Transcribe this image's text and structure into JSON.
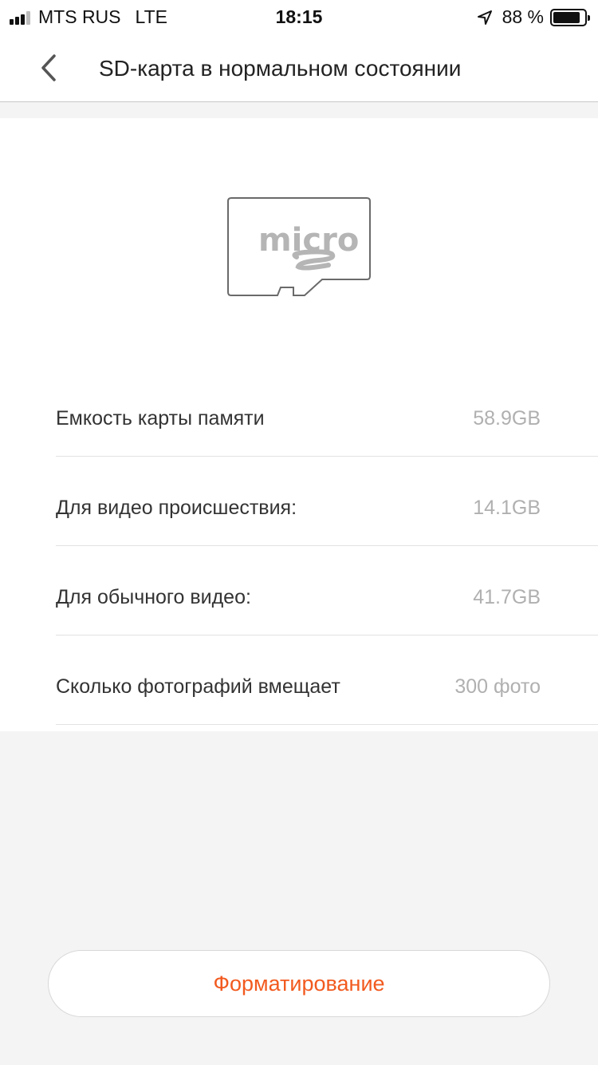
{
  "status_bar": {
    "carrier": "MTS RUS",
    "network": "LTE",
    "time": "18:15",
    "battery_percent": "88 %",
    "battery_level": 0.88
  },
  "nav": {
    "title": "SD-карта в нормальном состоянии"
  },
  "illustration": {
    "icon": "microsd-card-icon"
  },
  "info": {
    "rows": [
      {
        "label": "Емкость карты памяти",
        "value": "58.9GB"
      },
      {
        "label": "Для видео происшествия:",
        "value": "14.1GB"
      },
      {
        "label": "Для обычного видео:",
        "value": "41.7GB"
      },
      {
        "label": "Сколько фотографий вмещает",
        "value": "300 фото"
      }
    ]
  },
  "actions": {
    "format_label": "Форматирование"
  },
  "colors": {
    "accent": "#f25a1f",
    "background": "#f4f4f4",
    "value_text": "#b0b0b0"
  }
}
